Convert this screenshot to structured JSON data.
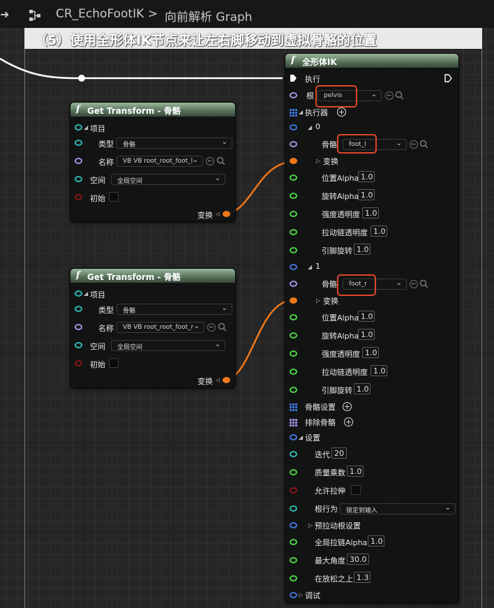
{
  "topbar": {
    "breadcrumb_1": "CR_EchoFootIK",
    "separator": ">",
    "breadcrumb_2": "向前解析 Graph"
  },
  "comment": {
    "text": "（5）使用全形体IK节点来让左右脚移动到虚拟骨骼的位置"
  },
  "get_transform_nodes": [
    {
      "title": "Get Transform - 骨骼",
      "item_label": "项目",
      "type_label": "类型",
      "type_value": "骨骼",
      "name_label": "名称",
      "name_value": "VB VB root_root_foot_l",
      "space_label": "空间",
      "space_value": "全局空间",
      "initial_label": "初始",
      "output_label": "变换"
    },
    {
      "title": "Get Transform - 骨骼",
      "item_label": "项目",
      "type_label": "类型",
      "type_value": "骨骼",
      "name_label": "名称",
      "name_value": "VB VB root_root_foot_r",
      "space_label": "空间",
      "space_value": "全局空间",
      "initial_label": "初始",
      "output_label": "变换"
    }
  ],
  "fbik": {
    "title": "全形体IK",
    "exec_label": "执行",
    "root_label": "根",
    "root_value": "pelvis",
    "effectors_label": "执行器",
    "effectors": [
      {
        "index": "0",
        "bone_label": "骨骼",
        "bone_value": "foot_l",
        "transform_label": "变换",
        "position_alpha_label": "位置Alpha",
        "position_alpha": "1.0",
        "rotation_alpha_label": "旋转Alpha",
        "rotation_alpha": "1.0",
        "strength_alpha_label": "强度透明度",
        "strength_alpha": "1.0",
        "pull_chain_alpha_label": "拉动链透明度",
        "pull_chain_alpha": "1.0",
        "pin_rotation_label": "引脚旋转",
        "pin_rotation": "1.0"
      },
      {
        "index": "1",
        "bone_label": "骨骼",
        "bone_value": "foot_r",
        "transform_label": "变换",
        "position_alpha_label": "位置Alpha",
        "position_alpha": "1.0",
        "rotation_alpha_label": "旋转Alpha",
        "rotation_alpha": "1.0",
        "strength_alpha_label": "强度透明度",
        "strength_alpha": "1.0",
        "pull_chain_alpha_label": "拉动链透明度",
        "pull_chain_alpha": "1.0",
        "pin_rotation_label": "引脚旋转",
        "pin_rotation": "1.0"
      }
    ],
    "bone_settings_label": "骨骼设置",
    "excluded_bones_label": "排除骨骼",
    "settings": {
      "label": "设置",
      "iterations_label": "迭代",
      "iterations": "20",
      "mass_multiplier_label": "质量乘数",
      "mass_multiplier": "1.0",
      "allow_stretch_label": "允许拉伸",
      "root_behavior_label": "根行为",
      "root_behavior_value": "锁定到输入",
      "pre_pull_root_label": "预拉动根设置",
      "global_pull_chain_alpha_label": "全局拉链Alpha",
      "global_pull_chain_alpha": "1.0",
      "max_angle_label": "最大角度",
      "max_angle": "30.0",
      "over_relaxation_label": "在放松之上",
      "over_relaxation": "1.3"
    },
    "debug_label": "调试"
  },
  "colors": {
    "header_green": "#55705a",
    "highlight_red": "#e0462a",
    "wire_orange": "#f07818",
    "exec_white": "#ffffff"
  }
}
